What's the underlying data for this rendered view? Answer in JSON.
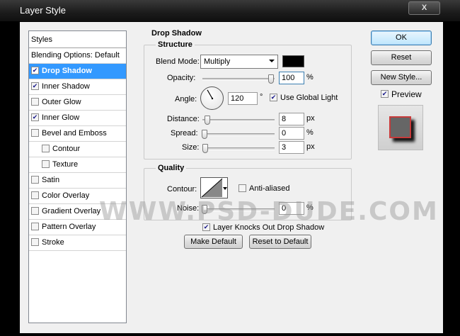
{
  "window": {
    "title": "Layer Style",
    "close_label": "X"
  },
  "styles_list": {
    "header": "Styles",
    "items": [
      {
        "label": "Blending Options: Default",
        "checkbox": false,
        "checked": false,
        "selected": false,
        "sub": false
      },
      {
        "label": "Drop Shadow",
        "checkbox": true,
        "checked": true,
        "selected": true,
        "sub": false
      },
      {
        "label": "Inner Shadow",
        "checkbox": true,
        "checked": true,
        "selected": false,
        "sub": false
      },
      {
        "label": "Outer Glow",
        "checkbox": true,
        "checked": false,
        "selected": false,
        "sub": false
      },
      {
        "label": "Inner Glow",
        "checkbox": true,
        "checked": true,
        "selected": false,
        "sub": false
      },
      {
        "label": "Bevel and Emboss",
        "checkbox": true,
        "checked": false,
        "selected": false,
        "sub": false
      },
      {
        "label": "Contour",
        "checkbox": true,
        "checked": false,
        "selected": false,
        "sub": true
      },
      {
        "label": "Texture",
        "checkbox": true,
        "checked": false,
        "selected": false,
        "sub": true
      },
      {
        "label": "Satin",
        "checkbox": true,
        "checked": false,
        "selected": false,
        "sub": false
      },
      {
        "label": "Color Overlay",
        "checkbox": true,
        "checked": false,
        "selected": false,
        "sub": false
      },
      {
        "label": "Gradient Overlay",
        "checkbox": true,
        "checked": false,
        "selected": false,
        "sub": false
      },
      {
        "label": "Pattern Overlay",
        "checkbox": true,
        "checked": false,
        "selected": false,
        "sub": false
      },
      {
        "label": "Stroke",
        "checkbox": true,
        "checked": false,
        "selected": false,
        "sub": false
      }
    ]
  },
  "drop_shadow": {
    "title": "Drop Shadow",
    "structure": {
      "title": "Structure",
      "blend_mode_label": "Blend Mode:",
      "blend_mode_value": "Multiply",
      "shadow_color": "#000000",
      "opacity_label": "Opacity:",
      "opacity_value": "100",
      "opacity_percent": 100,
      "angle_label": "Angle:",
      "angle_value": "120",
      "angle_unit": "°",
      "use_global_light_label": "Use Global Light",
      "use_global_light_checked": true,
      "distance_label": "Distance:",
      "distance_value": "8",
      "distance_fraction": 0.04,
      "spread_label": "Spread:",
      "spread_value": "0",
      "spread_fraction": 0,
      "size_label": "Size:",
      "size_value": "3",
      "size_fraction": 0.015,
      "percent_unit": "%",
      "px_unit": "px"
    },
    "quality": {
      "title": "Quality",
      "contour_label": "Contour:",
      "anti_aliased_label": "Anti-aliased",
      "anti_aliased_checked": false,
      "noise_label": "Noise:",
      "noise_value": "0",
      "noise_percent": 0,
      "percent_unit": "%"
    },
    "layer_knocks_out_label": "Layer Knocks Out Drop Shadow",
    "layer_knocks_out_checked": true,
    "make_default_label": "Make Default",
    "reset_to_default_label": "Reset to Default"
  },
  "buttons": {
    "ok": "OK",
    "reset": "Reset",
    "new_style": "New Style..."
  },
  "preview": {
    "label": "Preview",
    "checked": true,
    "fill_color": "#666666",
    "stroke_color": "#c73b3b"
  },
  "watermark": "WWW.PSD-DUDE.COM"
}
